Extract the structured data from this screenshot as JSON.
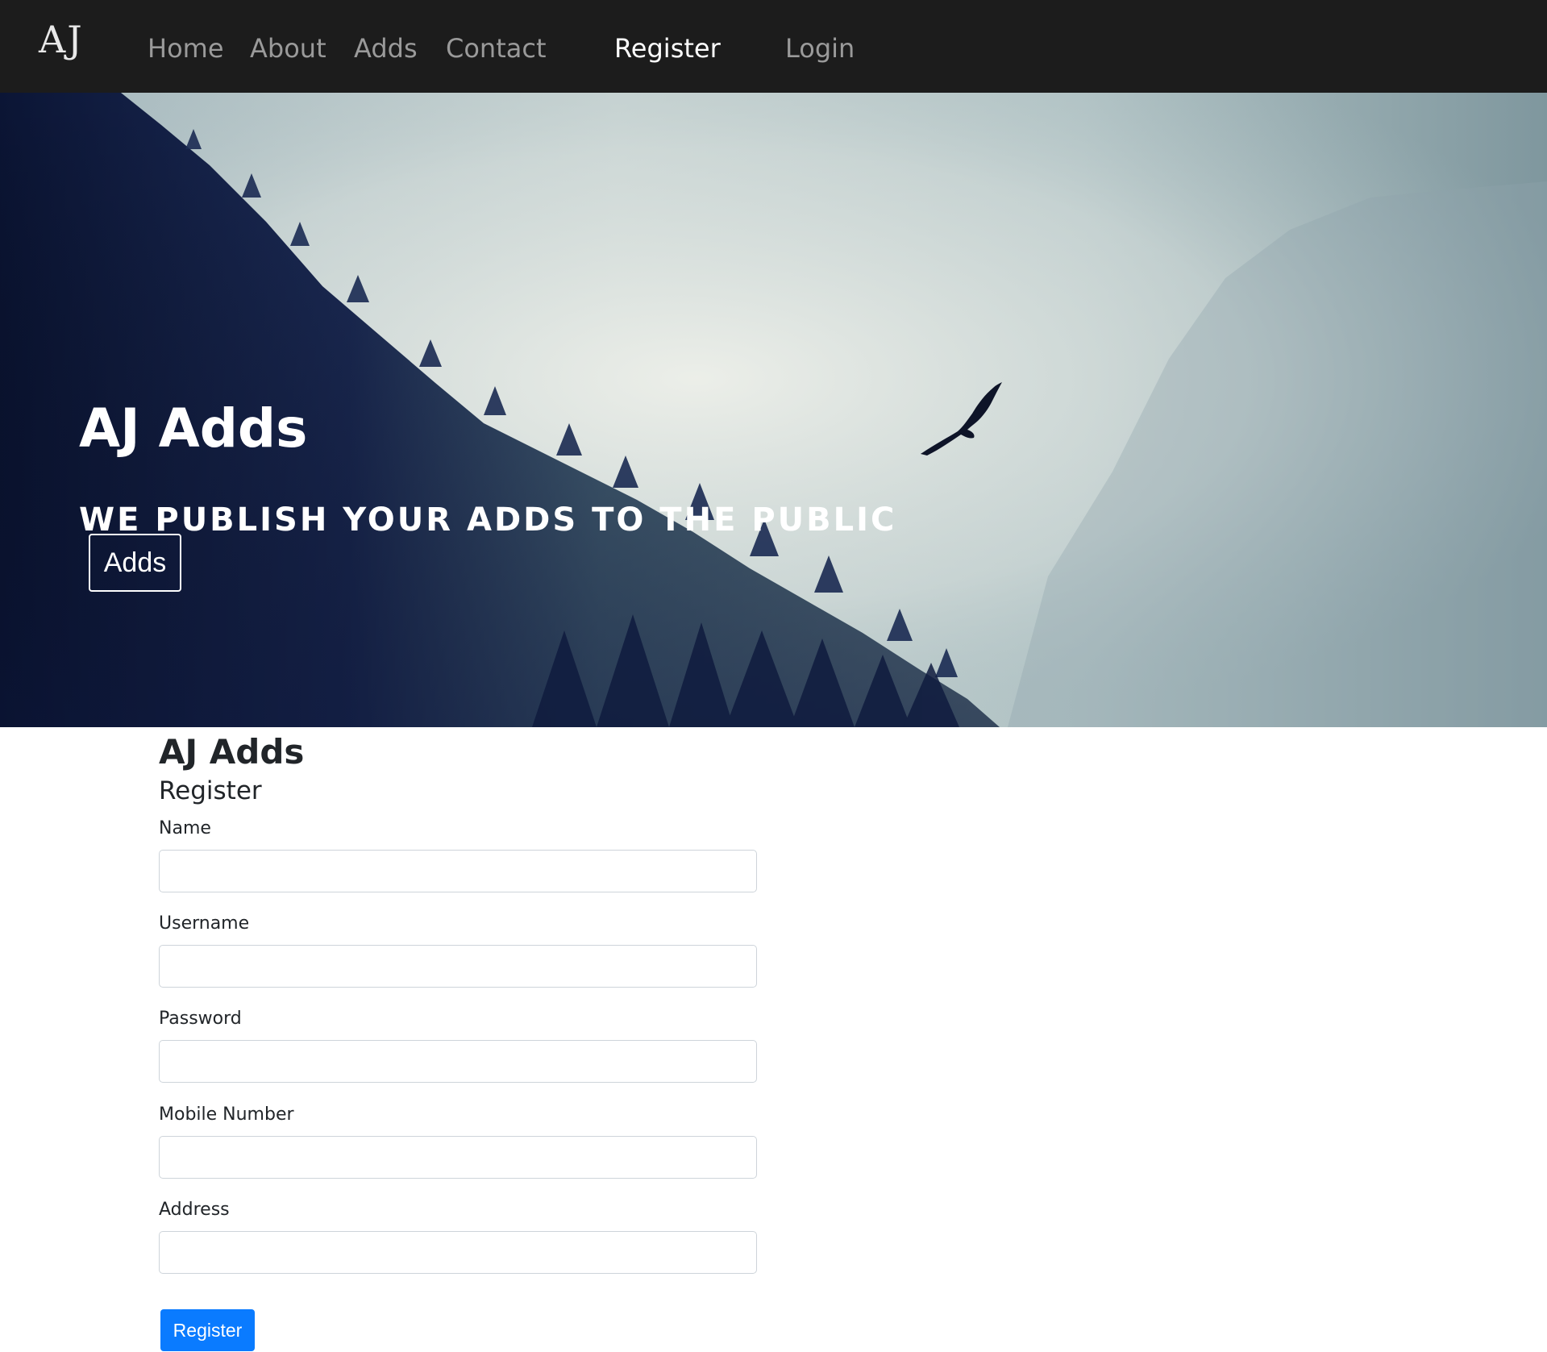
{
  "navbar": {
    "brand": "AJ",
    "links": [
      {
        "label": "Home"
      },
      {
        "label": "About"
      },
      {
        "label": "Adds"
      },
      {
        "label": "Contact"
      },
      {
        "label": "Register",
        "active": true
      },
      {
        "label": "Login"
      }
    ]
  },
  "hero": {
    "title": "AJ Adds",
    "subtitle": "WE PUBLISH YOUR ADDS TO THE PUBLIC",
    "button_label": "Adds",
    "icon": "eagle-silhouette"
  },
  "main": {
    "heading": "AJ Adds",
    "form_title": "Register",
    "fields": [
      {
        "label": "Name",
        "value": "",
        "placeholder": ""
      },
      {
        "label": "Username",
        "value": "",
        "placeholder": ""
      },
      {
        "label": "Password",
        "value": "",
        "placeholder": ""
      },
      {
        "label": "Mobile Number",
        "value": "",
        "placeholder": ""
      },
      {
        "label": "Address",
        "value": "",
        "placeholder": ""
      }
    ],
    "submit_label": "Register"
  },
  "colors": {
    "navbar_bg": "#1c1c1c",
    "nav_link": "#9a9a9a",
    "nav_link_active": "#ffffff",
    "primary_button": "#0a7bff"
  }
}
